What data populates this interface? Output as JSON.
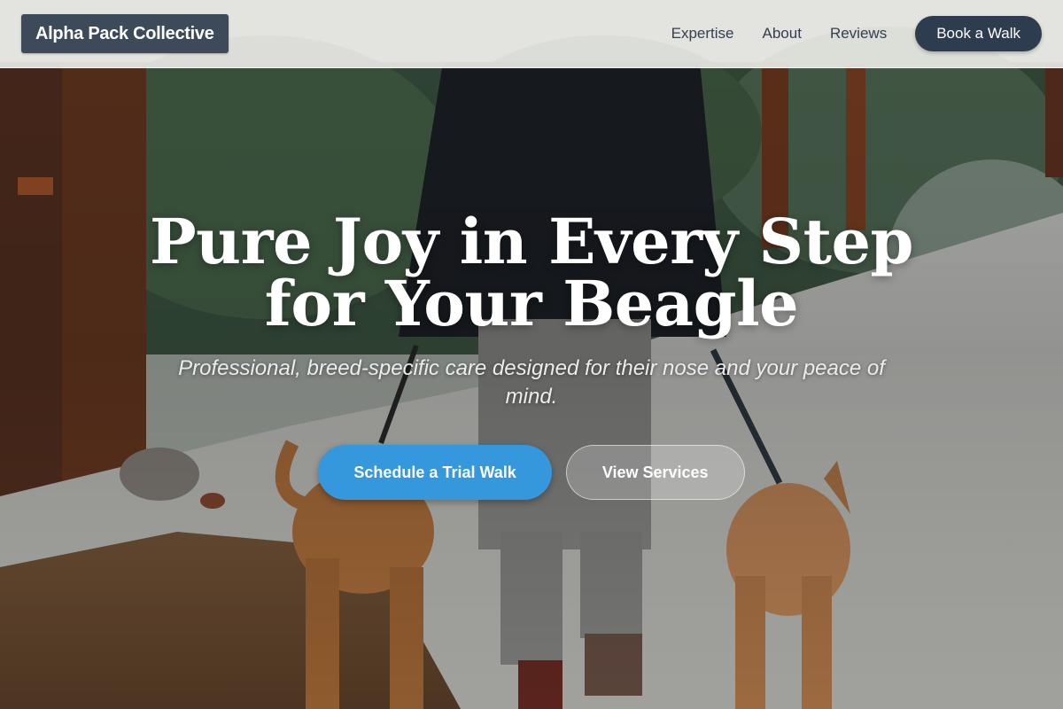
{
  "header": {
    "brand": "Alpha Pack Collective",
    "nav": [
      "Expertise",
      "About",
      "Reviews"
    ],
    "cta": "Book a Walk"
  },
  "hero": {
    "headline": "Pure Joy in Every Step for Your Beagle",
    "subheadline": "Professional, breed-specific care designed for their nose and your peace of mind.",
    "primary_button": "Schedule a Trial Walk",
    "secondary_button": "View Services",
    "background_image": "person walking two dogs on a snowy forest trail"
  },
  "colors": {
    "brand_bg": "#3d4a5a",
    "nav_text": "#34404e",
    "book_button": "#2e3c50",
    "primary_button": "#3597dc"
  }
}
